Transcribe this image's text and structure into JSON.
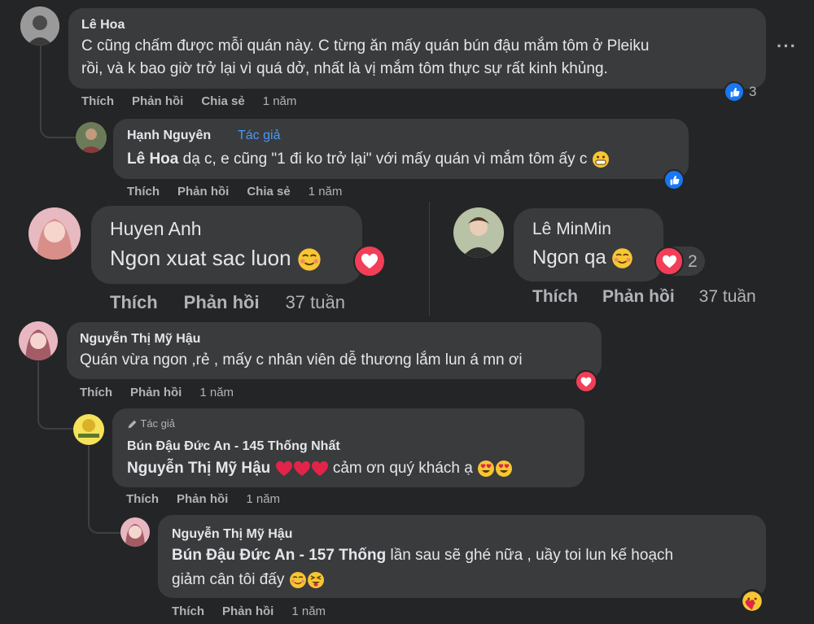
{
  "comments": [
    {
      "name": "Lê Hoa",
      "lines": [
        "C cũng chấm được mỗi quán này. C từng ăn mấy quán bún đậu mắm tôm ở Pleiku",
        "rồi, và k bao giờ trở lại vì quá dở, nhất là vị mắm tôm thực sự rất kinh khủng."
      ],
      "actions": [
        "Thích",
        "Phản hồi",
        "Chia sẻ"
      ],
      "time": "1 năm",
      "reaction_count": "3"
    },
    {
      "name": "Hạnh Nguyên",
      "author_tag": "Tác giả",
      "mention": "Lê Hoa",
      "text": " dạ c, e cũng \"1 đi ko trở lại\" với mấy quán vì mắm tôm ấy c",
      "actions": [
        "Thích",
        "Phản hồi",
        "Chia sẻ"
      ],
      "time": "1 năm"
    },
    {
      "name": "Huyen Anh",
      "text": "Ngon xuat sac luon",
      "actions": [
        "Thích",
        "Phản hồi"
      ],
      "time": "37 tuần"
    },
    {
      "name": "Lê MinMin",
      "text": "Ngon qa",
      "actions": [
        "Thích",
        "Phản hồi"
      ],
      "time": "37 tuần",
      "reaction_count": "2"
    },
    {
      "name": "Nguyễn Thị Mỹ Hậu",
      "text": "Quán vừa ngon ,rẻ , mấy c nhân viên dễ thương lắm lun á mn ơi",
      "actions": [
        "Thích",
        "Phản hồi"
      ],
      "time": "1 năm"
    },
    {
      "author_tag": "Tác giả",
      "name": "Bún Đậu Đức An - 145 Thống Nhất",
      "mention": "Nguyễn Thị Mỹ Hậu",
      "text": " cảm ơn quý khách ạ",
      "actions": [
        "Thích",
        "Phản hồi"
      ],
      "time": "1 năm"
    },
    {
      "name": "Nguyễn Thị Mỹ Hậu",
      "mention": "Bún Đậu Đức An - 157 Thống",
      "text": " lần sau sẽ ghé nữa , uầy toi lun kế hoạch",
      "line2": "giảm cân tôi đấy",
      "actions": [
        "Thích",
        "Phản hồi"
      ],
      "time": "1 năm"
    }
  ],
  "icons": {
    "more": "more-options-icon",
    "like": "like-reaction-icon",
    "love": "love-reaction-icon",
    "care": "care-reaction-icon",
    "pencil": "pencil-icon"
  },
  "colors": {
    "background": "#242526",
    "bubble": "#3a3b3c",
    "author_tag": "#4599ff",
    "like": "#1877f2",
    "love": "#f33e58"
  }
}
